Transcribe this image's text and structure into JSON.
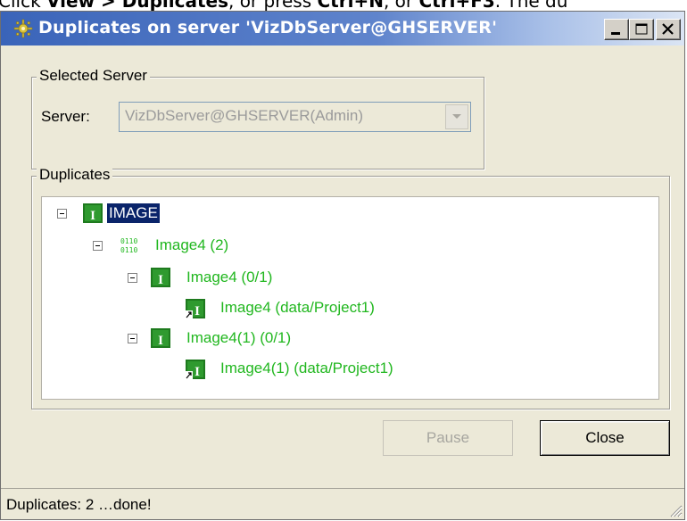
{
  "background_doc": {
    "text_prefix": "Click ",
    "view": "View",
    "arrow": " > ",
    "duplicates": "Duplicates",
    "mid": ", or press ",
    "ctrl_n": "Ctrl+N",
    "or": ", or ",
    "ctrl_f3": "Ctrl+F3",
    "tail": ". The du"
  },
  "window": {
    "title": "Duplicates on server 'VizDbServer@GHSERVER'",
    "icon": "gear-icon"
  },
  "selected_server": {
    "legend": "Selected Server",
    "server_label": "Server:",
    "server_value": "VizDbServer@GHSERVER(Admin)"
  },
  "duplicates": {
    "legend": "Duplicates",
    "tree": [
      {
        "label": "IMAGE",
        "icon": "image-type-icon",
        "selected": true
      },
      {
        "label": "Image4 (2)",
        "icon": "binary-data-icon"
      },
      {
        "label": "Image4 (0/1)",
        "icon": "image-type-icon"
      },
      {
        "label": "Image4 (data/Project1)",
        "icon": "image-shortcut-icon"
      },
      {
        "label": "Image4(1) (0/1)",
        "icon": "image-type-icon"
      },
      {
        "label": "Image4(1) (data/Project1)",
        "icon": "image-shortcut-icon"
      }
    ]
  },
  "buttons": {
    "pause": "Pause",
    "close": "Close"
  },
  "status": {
    "text": "Duplicates: 2 …done!"
  },
  "colors": {
    "title_start": "#3a64b9",
    "tree_text": "#21b71f",
    "selection": "#0a246a",
    "window_bg": "#ece9d8"
  }
}
